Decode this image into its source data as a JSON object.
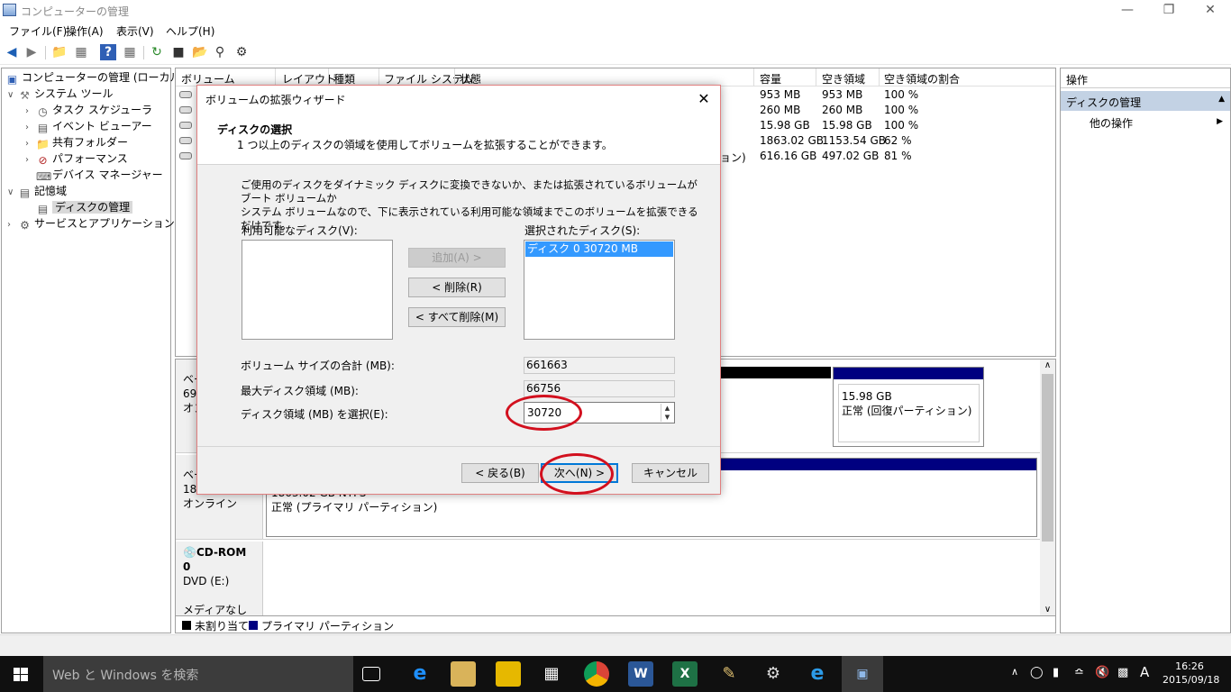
{
  "window": {
    "title": "コンピューターの管理",
    "min": "—",
    "restore": "❐",
    "close": "✕"
  },
  "menu": [
    "ファイル(F)",
    "操作(A)",
    "表示(V)",
    "ヘルプ(H)"
  ],
  "tree": {
    "root": "コンピューターの管理 (ローカル)",
    "system_tools": "システム ツール",
    "task_scheduler": "タスク スケジューラ",
    "event_viewer": "イベント ビューアー",
    "shared_folders": "共有フォルダー",
    "performance": "パフォーマンス",
    "device_manager": "デバイス マネージャー",
    "storage": "記憶域",
    "disk_management": "ディスクの管理",
    "services_apps": "サービスとアプリケーション"
  },
  "volume_list": {
    "headers": [
      "ボリューム",
      "レイアウト",
      "種類",
      "ファイル システム",
      "状態",
      "容量",
      "空き領域",
      "空き領域の割合"
    ],
    "rows": [
      {
        "capacity": "953 MB",
        "free": "953 MB",
        "pct": "100 %"
      },
      {
        "capacity": "260 MB",
        "free": "260 MB",
        "pct": "100 %"
      },
      {
        "capacity": "15.98 GB",
        "free": "15.98 GB",
        "pct": "100 %"
      },
      {
        "capacity": "1863.02 GB",
        "free": "1153.54 GB",
        "pct": "62 %"
      },
      {
        "status_tail": "ション)",
        "capacity": "616.16 GB",
        "free": "497.02 GB",
        "pct": "81 %"
      }
    ]
  },
  "disks": {
    "disk0_label_a": "ベー",
    "disk0_label_b": "698",
    "disk0_label_c": "オン",
    "disk0_part_size": "15.98 GB",
    "disk0_part_status": "正常 (回復パーティション)",
    "disk1_label_a": "ベー",
    "disk1_label_b": "1863.02 GB",
    "disk1_label_c": "オンライン",
    "disk1_part_size": "1863.02 GB NTFS",
    "disk1_part_status": "正常 (プライマリ パーティション)",
    "cdrom_name": "CD-ROM 0",
    "cdrom_drive": "DVD (E:)",
    "cdrom_status": "メディアなし"
  },
  "legend": {
    "unallocated": "未割り当て",
    "primary": "プライマリ パーティション"
  },
  "actions": {
    "header": "操作",
    "selected": "ディスクの管理",
    "other": "他の操作"
  },
  "dialog": {
    "title": "ボリュームの拡張ウィザード",
    "close": "✕",
    "heading": "ディスクの選択",
    "subheading": "1 つ以上のディスクの領域を使用してボリュームを拡張することができます。",
    "description_1": "ご使用のディスクをダイナミック ディスクに変換できないか、または拡張されているボリュームがブート ボリュームか",
    "description_2": "システム ボリュームなので、下に表示されている利用可能な領域までこのボリュームを拡張できるだけです。",
    "available_label": "利用可能なディスク(V):",
    "selected_label": "選択されたディスク(S):",
    "selected_disk": "ディスク 0     30720 MB",
    "add_button": "追加(A) >",
    "remove_button": "< 削除(R)",
    "remove_all_button": "< すべて削除(M)",
    "total_size_label": "ボリューム サイズの合計 (MB):",
    "total_size_value": "661663",
    "max_space_label": "最大ディスク領域 (MB):",
    "max_space_value": "66756",
    "select_space_label": "ディスク領域 (MB) を選択(E):",
    "select_space_value": "30720",
    "back_button": "< 戻る(B)",
    "next_button": "次へ(N) >",
    "cancel_button": "キャンセル"
  },
  "taskbar": {
    "search_placeholder": "Web と Windows を検索",
    "ime": "A",
    "time": "16:26",
    "date": "2015/09/18"
  },
  "colors": {
    "primary_partition": "#000080",
    "unallocated": "#000000",
    "highlight": "#d2101e"
  }
}
